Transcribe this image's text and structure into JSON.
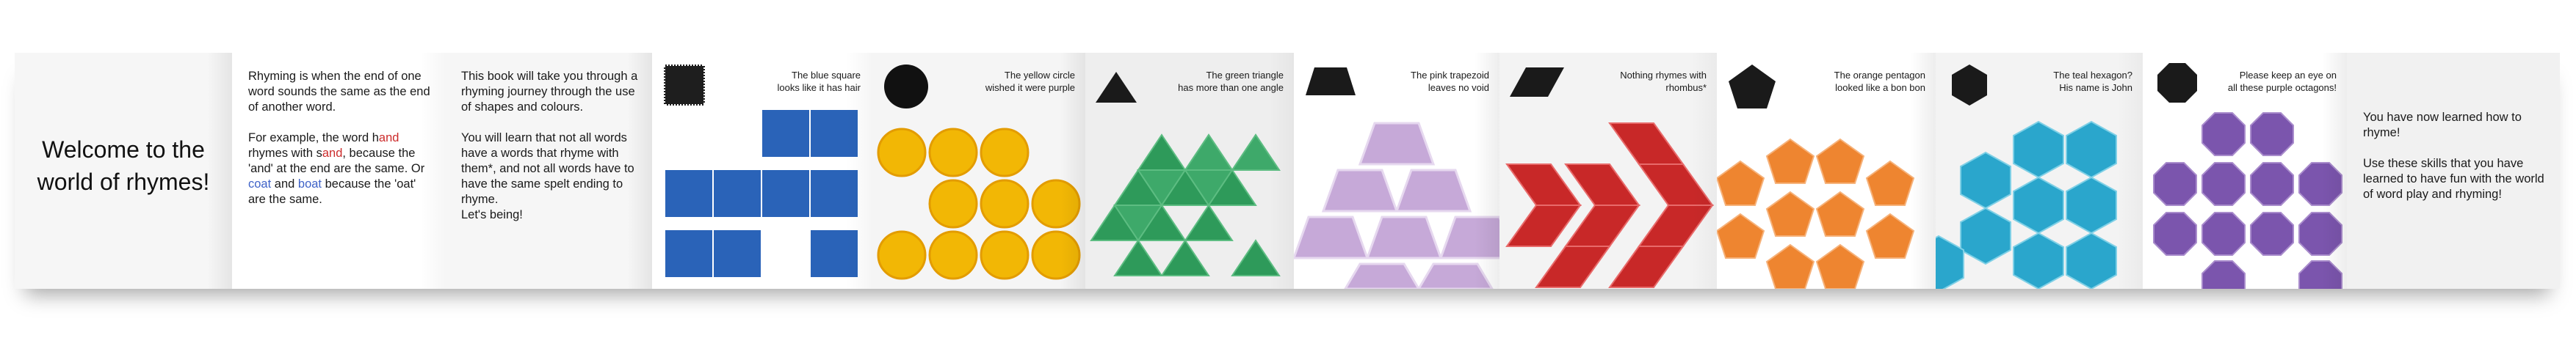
{
  "cover": {
    "title_line1": "Welcome to the",
    "title_line2": "world of rhymes!"
  },
  "intro": {
    "p1": "Rhyming is when the end of one word sounds the same as the end of another word.",
    "p2_a": "For example, the word h",
    "p2_and1": "and",
    "p2_b": " rhymes with s",
    "p2_and2": "and",
    "p2_c": ", because the 'and' at the end are the same. Or ",
    "p2_coat": "coat",
    "p2_d": " and ",
    "p2_boat": "boat",
    "p2_e": " because the 'oat' are the same."
  },
  "about": {
    "p1": "This book will take you through a rhyming journey through the use of shapes and colours.",
    "p2": "You will learn that not all words have a words that rhyme with them*, and not all words have to have the same spelt ending to rhyme.",
    "p3": "Let's being!"
  },
  "pages": [
    {
      "shape": "square",
      "icon": "square-icon",
      "color": "#2a63b8",
      "caption_line1": "The blue square",
      "caption_line2": "looks like it has hair"
    },
    {
      "shape": "circle",
      "icon": "circle-icon",
      "color": "#f2b705",
      "caption_line1": "The yellow circle",
      "caption_line2": "wished it were purple"
    },
    {
      "shape": "triangle",
      "icon": "triangle-icon",
      "color": "#2e9a5a",
      "caption_line1": "The green triangle",
      "caption_line2": "has more than one angle"
    },
    {
      "shape": "trapezoid",
      "icon": "trapezoid-icon",
      "color": "#c6a9d8",
      "caption_line1": "The pink trapezoid",
      "caption_line2": "leaves no void"
    },
    {
      "shape": "rhombus",
      "icon": "rhombus-icon",
      "color": "#c82828",
      "caption_line1": "Nothing rhymes with",
      "caption_line2": "rhombus*"
    },
    {
      "shape": "pentagon",
      "icon": "pentagon-icon",
      "color": "#ee8530",
      "caption_line1": "The orange pentagon",
      "caption_line2": "looked like a bon bon"
    },
    {
      "shape": "hexagon",
      "icon": "hexagon-icon",
      "color": "#2aa6cc",
      "caption_line1": "The teal hexagon?",
      "caption_line2": "His name is John"
    },
    {
      "shape": "octagon",
      "icon": "octagon-icon",
      "color": "#7b55ad",
      "caption_line1": "Please keep an eye on",
      "caption_line2": "all these purple octagons!"
    }
  ],
  "outro": {
    "p1": "You have now learned how to rhyme!",
    "p2": "Use these skills that you have learned to have fun with the world of word play and rhyming!"
  }
}
